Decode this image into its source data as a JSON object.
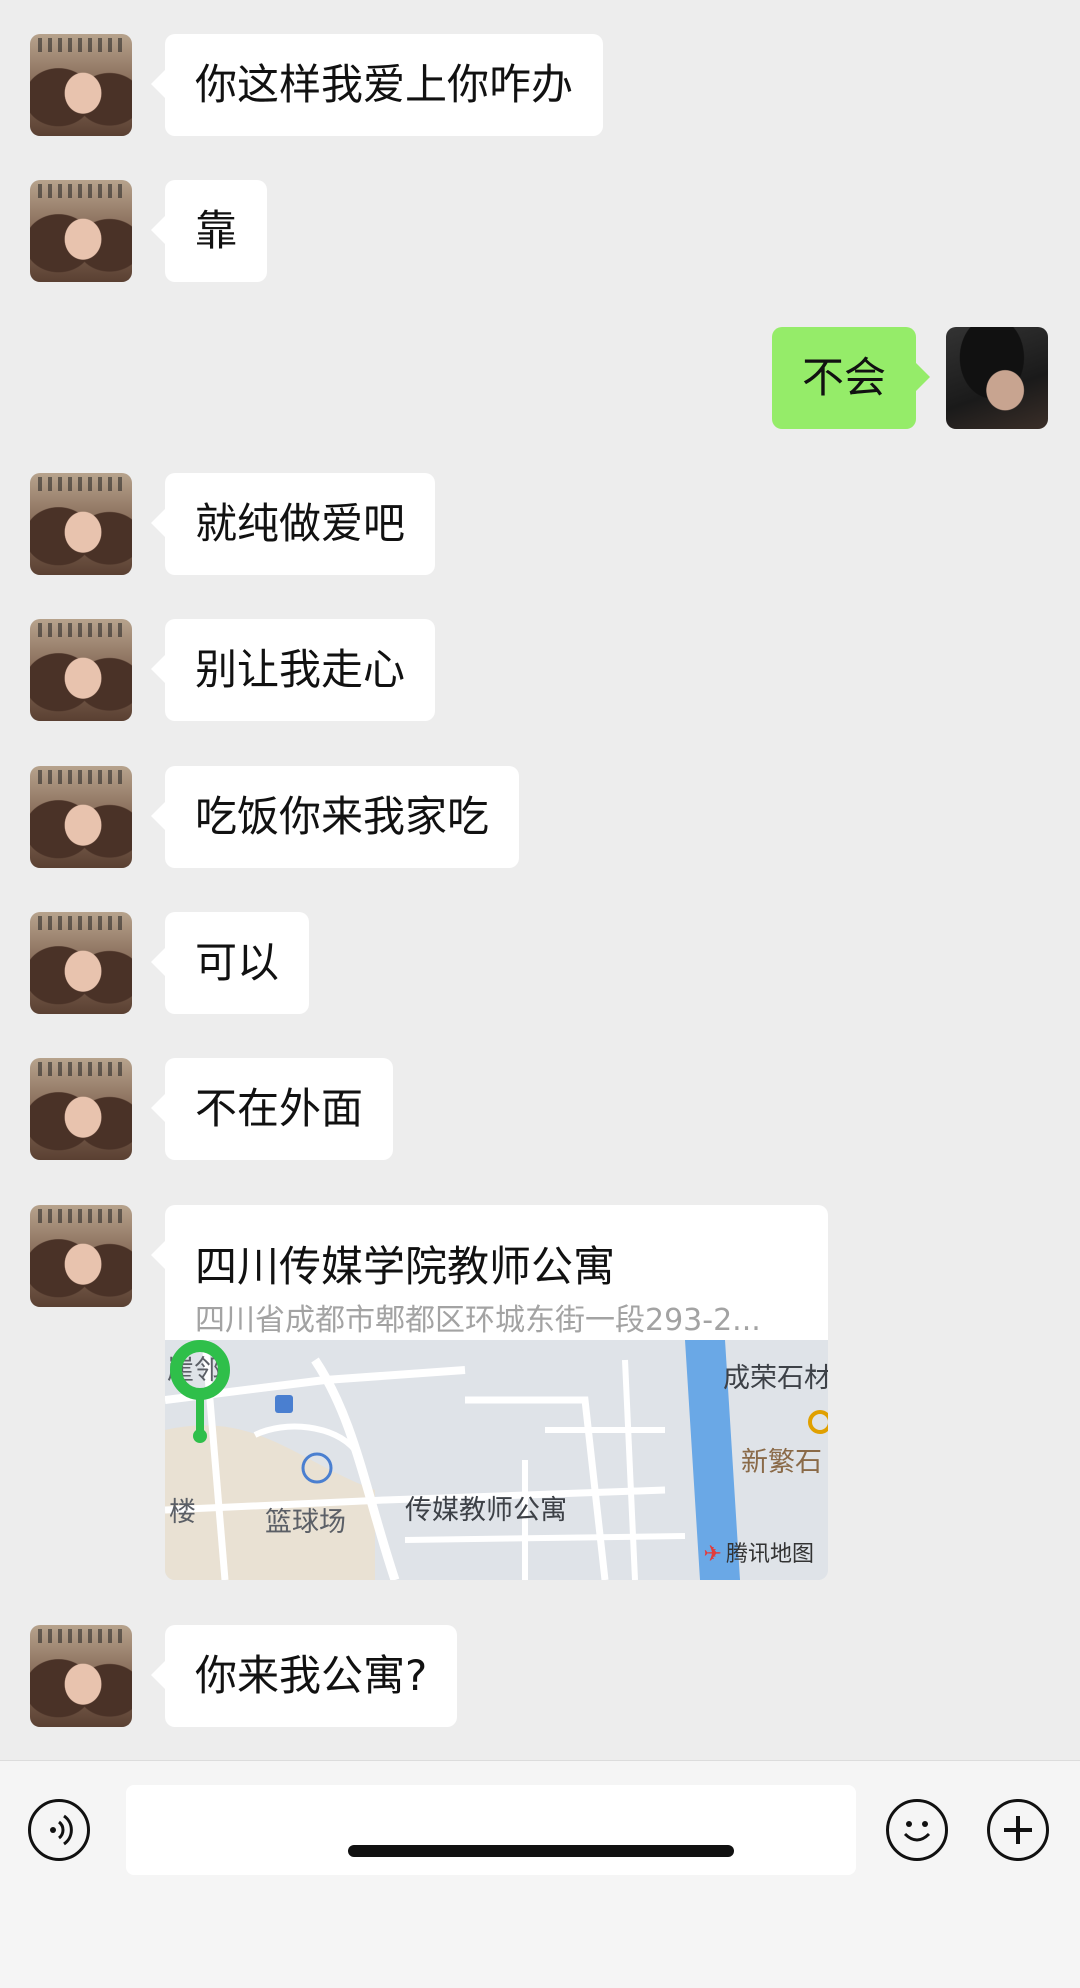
{
  "messages": [
    {
      "side": "them",
      "text": "你这样我爱上你咋办"
    },
    {
      "side": "them",
      "text": "靠"
    },
    {
      "side": "me",
      "text": "不会"
    },
    {
      "side": "them",
      "text": "就纯做爱吧"
    },
    {
      "side": "them",
      "text": "别让我走心"
    },
    {
      "side": "them",
      "text": "吃饭你来我家吃"
    },
    {
      "side": "them",
      "text": "可以"
    },
    {
      "side": "them",
      "text": "不在外面"
    },
    {
      "side": "them",
      "text": "你来我公寓?"
    }
  ],
  "location": {
    "title": "四川传媒学院教师公寓",
    "address": "四川省成都市郫都区环城东街一段293-2...",
    "map_labels": {
      "top_left": "崖邻",
      "top_right": "成荣石材",
      "right": "新繁石",
      "left": "楼",
      "court": "篮球场",
      "pin_label": "传媒教师公寓"
    },
    "map_brand": "腾讯地图",
    "pin_color": "#2fbf4a"
  },
  "input_bar": {
    "voice_icon": "voice-icon",
    "emoji_icon": "emoji-icon",
    "plus_icon": "plus-icon"
  },
  "colors": {
    "background": "#ededed",
    "bubble_them": "#ffffff",
    "bubble_me": "#95ec69"
  }
}
